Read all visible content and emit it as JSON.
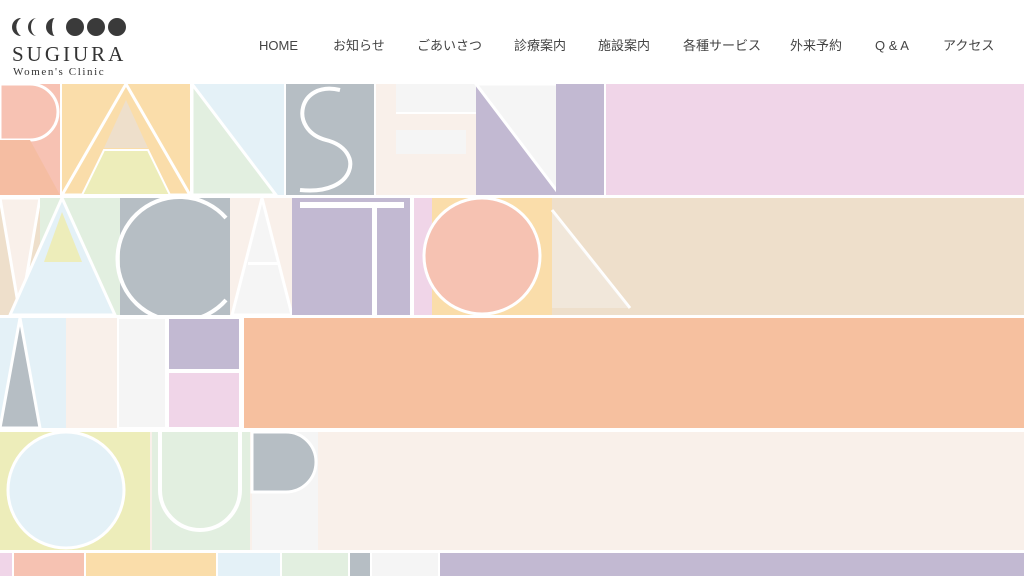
{
  "logo": {
    "name": "SUGIURA",
    "subtitle": "Women's Clinic",
    "icon": "moon-phases-icon"
  },
  "nav": {
    "items": [
      {
        "label": "HOME"
      },
      {
        "label": "お知らせ"
      },
      {
        "label": "ごあいさつ"
      },
      {
        "label": "診療案内"
      },
      {
        "label": "施設案内"
      },
      {
        "label": "各種サービス"
      },
      {
        "label": "外来予約"
      },
      {
        "label": "Q & A"
      },
      {
        "label": "アクセス"
      }
    ]
  },
  "hero": {
    "lines": [
      "TRANSFER",
      "VACATION",
      "WITH",
      "YOUR"
    ],
    "colors": {
      "pink": "#F0D5E8",
      "peach": "#F5BDA2",
      "salmon": "#F6C2B2",
      "beige": "#EEDFCB",
      "yellow": "#FADDAA",
      "lime": "#EDEDBA",
      "mint": "#E2EFE0",
      "sky": "#E4F1F7",
      "gray": "#B6BEC4",
      "lavender": "#C2B9D2",
      "cream": "#F9F0EA",
      "white": "#F5F5F5"
    }
  }
}
